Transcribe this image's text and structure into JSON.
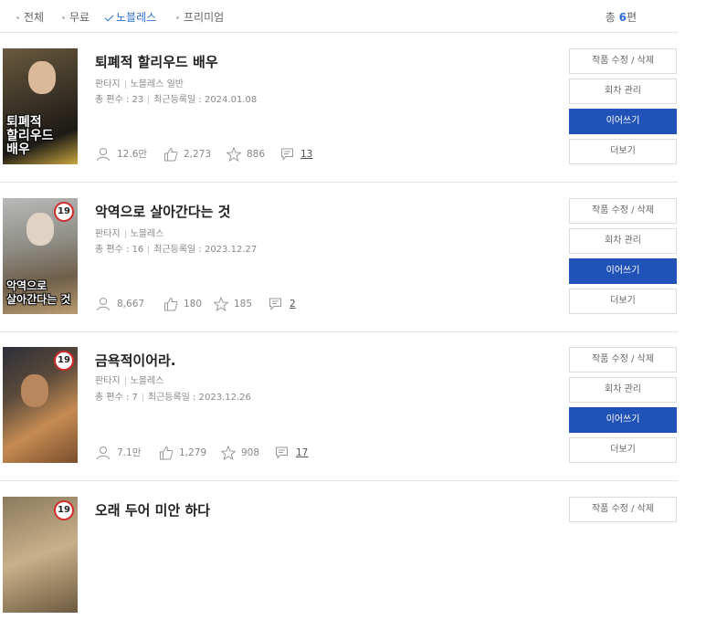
{
  "filters": [
    "전체",
    "무료",
    "노블레스",
    "프리미엄"
  ],
  "total": {
    "prefix": "총 ",
    "count": "6",
    "suffix": "편"
  },
  "buttons": {
    "edit": "작품 수정 / 삭제",
    "episodes": "회차 관리",
    "continue": "이어쓰기",
    "more": "더보기"
  },
  "colors": {
    "accent": "#2f6fd4",
    "primary_button": "#2152b8"
  },
  "works": [
    {
      "title": "퇴폐적 할리우드 배우",
      "genre": "판타지",
      "category": "노블레스 일반",
      "episodes": "총 편수 : 23",
      "updated": "최근등록일 : 2024.01.08",
      "views": "12.6만",
      "likes": "2,273",
      "favorites": "886",
      "comments": "13",
      "cover_text": [
        "퇴폐적",
        "할리우드",
        "배우"
      ],
      "age_badge": ""
    },
    {
      "title": "악역으로 살아간다는 것",
      "genre": "판타지",
      "category": "노블레스",
      "episodes": "총 편수 : 16",
      "updated": "최근등록일 : 2023.12.27",
      "views": "8,667",
      "likes": "180",
      "favorites": "185",
      "comments": "2",
      "cover_text": [
        "악역으로",
        "살아간다는 것"
      ],
      "age_badge": "19"
    },
    {
      "title": "금욕적이어라.",
      "genre": "판타지",
      "category": "노블레스",
      "episodes": "총 편수 : 7",
      "updated": "최근등록일 : 2023.12.26",
      "views": "7.1만",
      "likes": "1,279",
      "favorites": "908",
      "comments": "17",
      "cover_text": [],
      "age_badge": "19"
    },
    {
      "title": "오래 두어 미안 하다",
      "age_badge": "19"
    }
  ]
}
